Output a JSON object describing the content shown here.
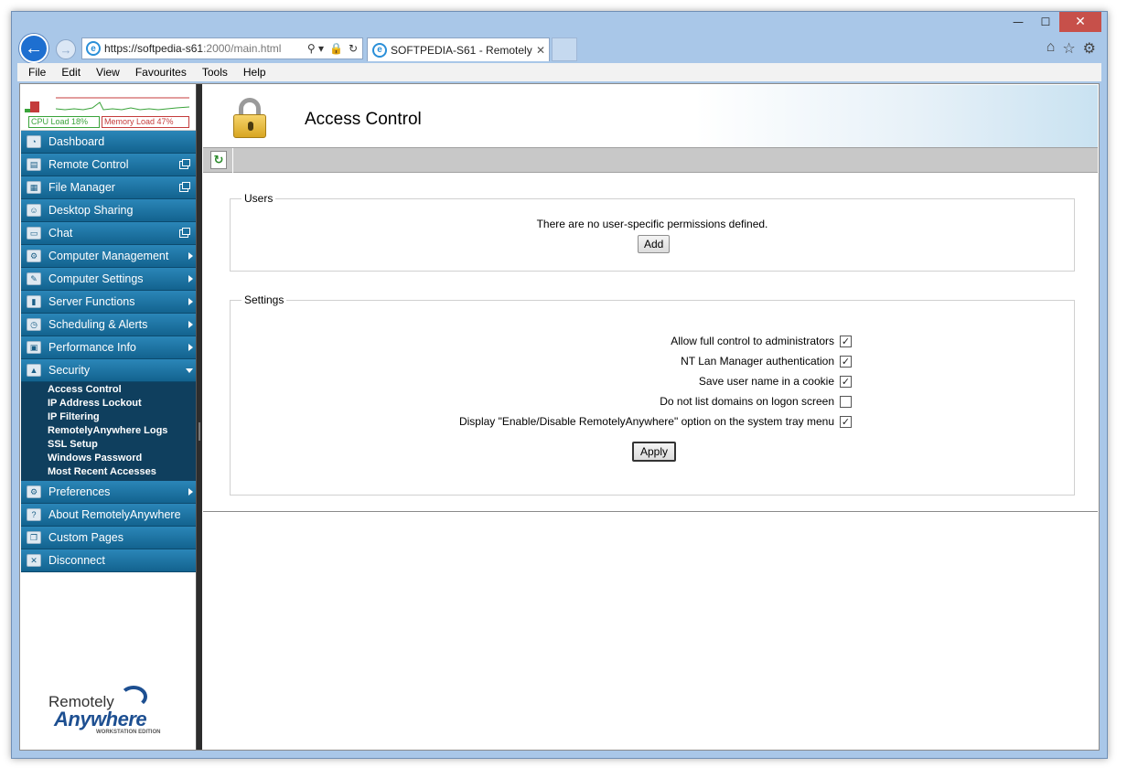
{
  "window": {
    "minimize_glyph": "—",
    "maximize_glyph": "☐",
    "close_glyph": "✕"
  },
  "browser": {
    "back_glyph": "←",
    "forward_glyph": "→",
    "address_prefix": "https://softpedia-s61",
    "address_rest": ":2000/main.html",
    "tab_title": "SOFTPEDIA-S61 - Remotely...",
    "tab_close": "✕",
    "addr_tools": [
      "⚲ ▾",
      "🔒",
      "↻"
    ],
    "right_icons": [
      "⌂",
      "☆",
      "⚙"
    ]
  },
  "menubar": [
    "File",
    "Edit",
    "View",
    "Favourites",
    "Tools",
    "Help"
  ],
  "monitor": {
    "cpu_label": "CPU Load 18%",
    "mem_label": "Memory Load 47%",
    "cpu_color": "#3aa33a",
    "mem_color": "#c43b3b"
  },
  "sidebar": {
    "items": [
      {
        "label": "Dashboard",
        "icon": "dashboard-icon",
        "glyph": "◔",
        "accessory": "none"
      },
      {
        "label": "Remote Control",
        "icon": "monitor-icon",
        "glyph": "▤",
        "accessory": "popout"
      },
      {
        "label": "File Manager",
        "icon": "file-manager-icon",
        "glyph": "▦",
        "accessory": "popout"
      },
      {
        "label": "Desktop Sharing",
        "icon": "people-icon",
        "glyph": "☺",
        "accessory": "none"
      },
      {
        "label": "Chat",
        "icon": "chat-icon",
        "glyph": "▭",
        "accessory": "popout"
      },
      {
        "label": "Computer Management",
        "icon": "computer-management-icon",
        "glyph": "⚙",
        "accessory": "arrow"
      },
      {
        "label": "Computer Settings",
        "icon": "computer-settings-icon",
        "glyph": "✎",
        "accessory": "arrow"
      },
      {
        "label": "Server Functions",
        "icon": "server-icon",
        "glyph": "▮",
        "accessory": "arrow"
      },
      {
        "label": "Scheduling & Alerts",
        "icon": "scheduling-icon",
        "glyph": "◷",
        "accessory": "arrow"
      },
      {
        "label": "Performance Info",
        "icon": "performance-icon",
        "glyph": "▣",
        "accessory": "arrow"
      },
      {
        "label": "Security",
        "icon": "security-lock-icon",
        "glyph": "▲",
        "accessory": "arrow-down"
      }
    ],
    "security_sub": [
      "Access Control",
      "IP Address Lockout",
      "IP Filtering",
      "RemotelyAnywhere Logs",
      "SSL Setup",
      "Windows Password",
      "Most Recent Accesses"
    ],
    "items_after": [
      {
        "label": "Preferences",
        "icon": "preferences-icon",
        "glyph": "⚙",
        "accessory": "arrow"
      },
      {
        "label": "About RemotelyAnywhere",
        "icon": "about-icon",
        "glyph": "?",
        "accessory": "none"
      },
      {
        "label": "Custom Pages",
        "icon": "custom-pages-icon",
        "glyph": "❐",
        "accessory": "none"
      },
      {
        "label": "Disconnect",
        "icon": "disconnect-icon",
        "glyph": "✕",
        "accessory": "none"
      }
    ]
  },
  "logo": {
    "line1": "Remotely",
    "line2": "Anywhere",
    "edition": "WORKSTATION EDITION"
  },
  "main": {
    "title": "Access Control",
    "refresh_glyph": "↻",
    "users": {
      "legend": "Users",
      "message": "There are no user-specific permissions defined.",
      "add_label": "Add"
    },
    "settings": {
      "legend": "Settings",
      "options": [
        {
          "label": "Allow full control to administrators",
          "checked": true
        },
        {
          "label": "NT Lan Manager authentication",
          "checked": true
        },
        {
          "label": "Save user name in a cookie",
          "checked": true
        },
        {
          "label": "Do not list domains on logon screen",
          "checked": false
        },
        {
          "label": "Display \"Enable/Disable RemotelyAnywhere\" option on the system tray menu",
          "checked": true
        }
      ],
      "apply_label": "Apply"
    }
  }
}
